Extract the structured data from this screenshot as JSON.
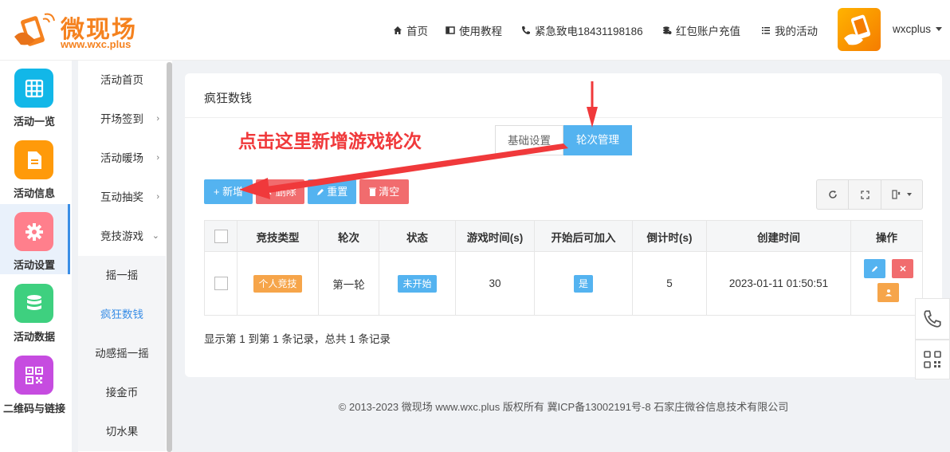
{
  "brand": {
    "name": "微现场",
    "url": "www.wxc.plus"
  },
  "header": {
    "nav": [
      {
        "label": "首页",
        "icon": "home-icon"
      },
      {
        "label": "使用教程",
        "icon": "book-icon"
      },
      {
        "label": "紧急致电18431198186",
        "icon": "phone-icon"
      },
      {
        "label": "红包账户充值",
        "icon": "coins-icon"
      },
      {
        "label": "我的活动",
        "icon": "list-icon"
      }
    ],
    "user": "wxcplus"
  },
  "sidebar": {
    "items": [
      {
        "label": "活动一览",
        "icon": "grid-icon",
        "color": "#12b7e8"
      },
      {
        "label": "活动信息",
        "icon": "document-icon",
        "color": "#ff9a0a"
      },
      {
        "label": "活动设置",
        "icon": "gear-icon",
        "color": "#ff7f8c"
      },
      {
        "label": "活动数据",
        "icon": "database-icon",
        "color": "#3ed07f"
      },
      {
        "label": "二维码与链接",
        "icon": "qrcode-icon",
        "color": "#c64ce0"
      }
    ]
  },
  "submenu": {
    "items": [
      {
        "label": "活动首页",
        "arrow": ""
      },
      {
        "label": "开场签到",
        "arrow": "›"
      },
      {
        "label": "活动暖场",
        "arrow": "›"
      },
      {
        "label": "互动抽奖",
        "arrow": "›"
      },
      {
        "label": "竞技游戏",
        "arrow": "⌄"
      },
      {
        "label": "摇一摇",
        "arrow": ""
      },
      {
        "label": "疯狂数钱",
        "arrow": ""
      },
      {
        "label": "动感摇一摇",
        "arrow": ""
      },
      {
        "label": "接金币",
        "arrow": ""
      },
      {
        "label": "切水果",
        "arrow": ""
      }
    ]
  },
  "page": {
    "title": "疯狂数钱",
    "annotation": "点击这里新增游戏轮次",
    "tabs": [
      "基础设置",
      "轮次管理"
    ],
    "buttons": {
      "add": "新增",
      "delete": "删除",
      "reset": "重置",
      "clear": "清空"
    },
    "table": {
      "columns": [
        "竞技类型",
        "轮次",
        "状态",
        "游戏时间(s)",
        "开始后可加入",
        "倒计时(s)",
        "创建时间",
        "操作"
      ],
      "rows": [
        {
          "type": "个人竞技",
          "round": "第一轮",
          "status": "未开始",
          "game_time": "30",
          "join_after_start": "是",
          "countdown": "5",
          "created": "2023-01-11 01:50:51"
        }
      ]
    },
    "pagination_info": "显示第 1 到第 1 条记录，总共 1 条记录"
  },
  "footer": "© 2013-2023 微现场 www.wxc.plus 版权所有 冀ICP备13002191号-8 石家庄微谷信息技术有限公司",
  "colors": {
    "primary": "#54b3f0",
    "danger": "#f16c6e",
    "warning": "#f6a54a",
    "annotation": "#f0393b"
  }
}
